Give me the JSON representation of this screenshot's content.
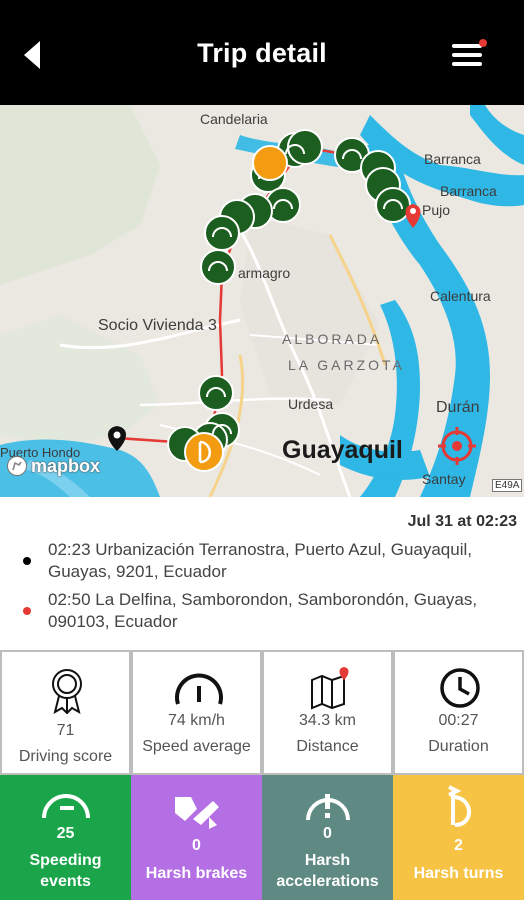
{
  "header": {
    "title": "Trip detail",
    "colors": {
      "background": "#000000",
      "text": "#ffffff",
      "notification_dot": "#e53935"
    }
  },
  "map": {
    "labels": {
      "candelaria": "Candelaria",
      "barranca": "Barranca",
      "barranca_2": "Barranca",
      "pujo": "Pujo",
      "armagro": "armagro",
      "calentura": "Calentura",
      "socio_vivienda": "Socio Vivienda 3",
      "alborada": "ALBORADA",
      "la_garzota": "LA GARZOTA",
      "urdesa": "Urdesa",
      "duran": "Durán",
      "puerto_hondo": "Puerto Hondo",
      "guayaquil": "Guayaquil",
      "santay": "Santay",
      "road_shield": "E49A",
      "mapbox": "mapbox"
    },
    "colors": {
      "route": "#e53935",
      "speeding_marker": "#1b5e20",
      "harsh_turn_marker": "#f39c12",
      "water": "#2fb7e6"
    }
  },
  "trip": {
    "date": "Jul 31 at 02:23",
    "start": {
      "time": "02:23",
      "address": "02:23 Urbanización Terranostra, Puerto Azul, Guayaquil, Guayas, 9201, Ecuador",
      "dot_color": "#000000"
    },
    "end": {
      "time": "02:50",
      "address": "02:50 La Delfina, Samborondon, Samborondón, Guayas, 090103, Ecuador",
      "dot_color": "#e53935"
    }
  },
  "stats": {
    "driving_score": {
      "value": "71",
      "label": "Driving score",
      "icon": "ribbon-award-icon"
    },
    "speed_average": {
      "value": "74 km/h",
      "label": "Speed average",
      "icon": "speedometer-icon"
    },
    "distance": {
      "value": "34.3 km",
      "label": "Distance",
      "icon": "map-pin-icon"
    },
    "duration": {
      "value": "00:27",
      "label": "Duration",
      "icon": "clock-icon"
    }
  },
  "events": {
    "speeding": {
      "value": "25",
      "label_line1": "Speeding",
      "label_line2": "events",
      "color": "#1aa54a",
      "icon": "speed-gauge-icon"
    },
    "harsh_brakes": {
      "value": "0",
      "label": "Harsh brakes",
      "color": "#b36fe3",
      "icon": "harsh-brake-icon"
    },
    "harsh_accelerations": {
      "value": "0",
      "label_line1": "Harsh",
      "label_line2": "accelerations",
      "color": "#5f8a83",
      "icon": "harsh-acceleration-icon"
    },
    "harsh_turns": {
      "value": "2",
      "label": "Harsh turns",
      "color": "#f6c344",
      "icon": "harsh-turn-icon"
    }
  }
}
